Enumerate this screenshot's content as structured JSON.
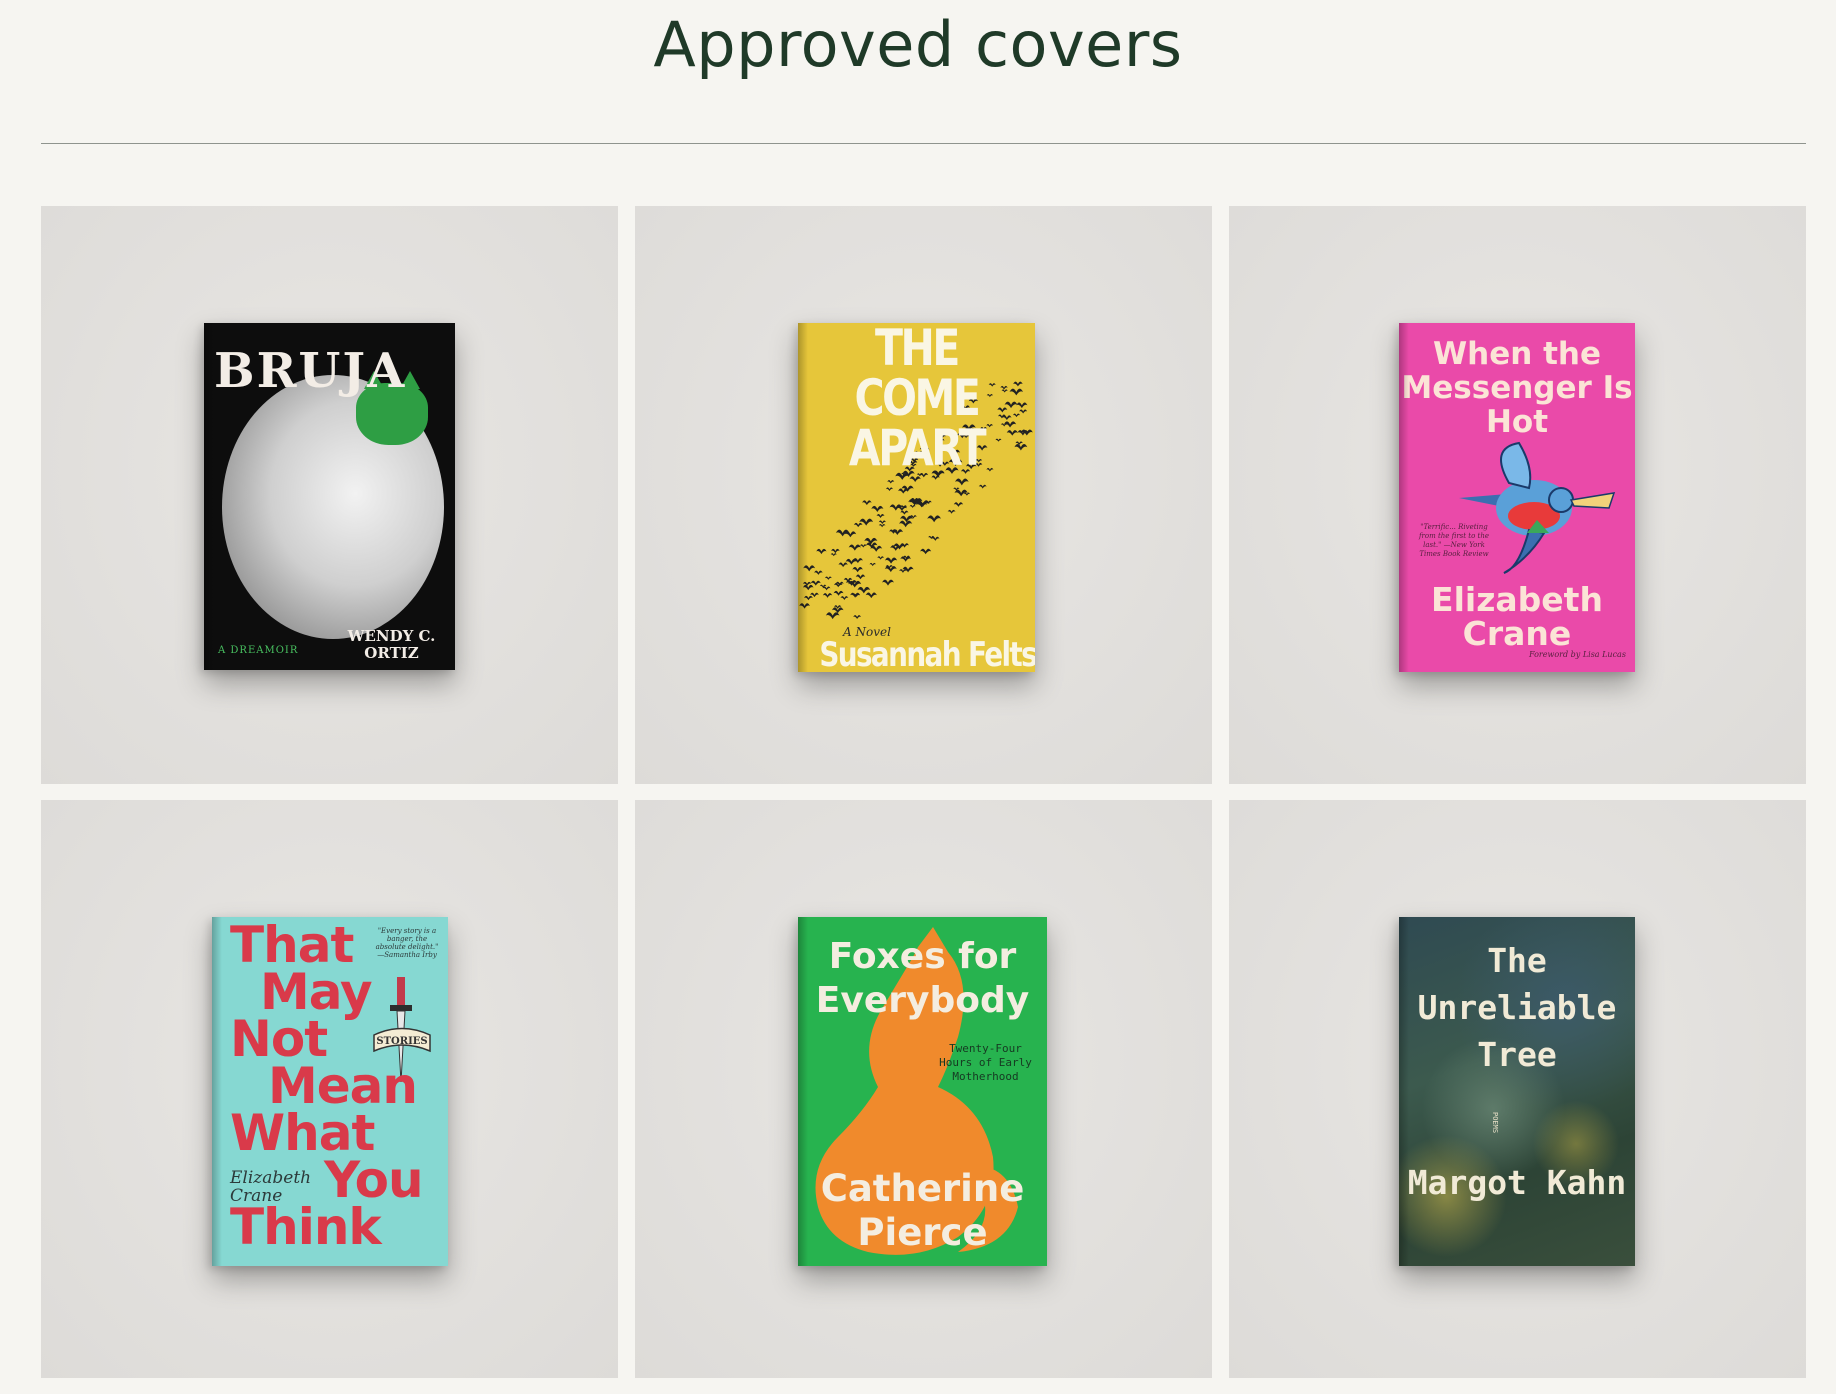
{
  "page": {
    "title": "Approved covers"
  },
  "covers": [
    {
      "title": "BRUJA",
      "subtitle": "A DREAMOIR",
      "author": "WENDY C. ORTIZ",
      "colors": {
        "background": "#0d0d0d",
        "accent": "#2e9e44"
      }
    },
    {
      "title": "THE COME APART",
      "subtitle": "A Novel",
      "author": "Susannah Felts",
      "colors": {
        "background": "#e6c63a"
      }
    },
    {
      "title": "When the Messenger Is Hot",
      "author": "Elizabeth Crane",
      "blurb": "\"Terrific... Riveting from the first to the last.\" —New York Times Book Review",
      "foreword": "Foreword by Lisa Lucas",
      "colors": {
        "background": "#ea4aa9"
      }
    },
    {
      "title_lines": [
        "That",
        "May",
        "Not",
        "Mean",
        "What",
        "You",
        "Think"
      ],
      "author": "Elizabeth Crane",
      "badge": "STORIES",
      "blurb": "\"Every story is a banger, the absolute delight.\" —Samantha Irby",
      "colors": {
        "background": "#86d8d2",
        "text": "#d93a4a"
      }
    },
    {
      "title": "Foxes for Everybody",
      "subtitle": "Twenty-Four Hours of Early Motherhood",
      "author": "Catherine Pierce",
      "colors": {
        "background": "#27b34f",
        "accent": "#f08a2c"
      }
    },
    {
      "title": "The Unreliable Tree",
      "genre": "POEMS",
      "author": "Margot Kahn",
      "colors": {
        "background": "#2f4a52"
      }
    }
  ]
}
